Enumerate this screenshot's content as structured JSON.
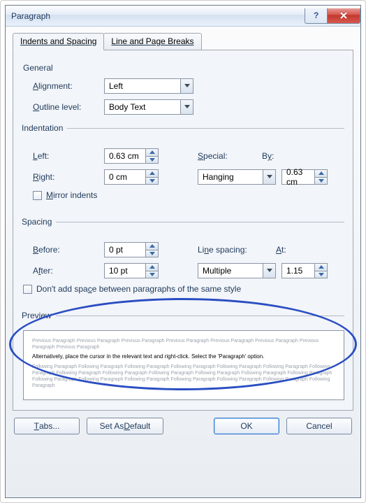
{
  "window": {
    "title": "Paragraph"
  },
  "tabs": {
    "indents": "Indents and Spacing",
    "linepage": "Line and Page Breaks"
  },
  "general": {
    "heading": "General",
    "alignment_label": "Alignment:",
    "alignment_value": "Left",
    "outline_label": "Outline level:",
    "outline_value": "Body Text"
  },
  "indentation": {
    "heading": "Indentation",
    "left_label": "Left:",
    "left_value": "0.63 cm",
    "right_label": "Right:",
    "right_value": "0 cm",
    "special_label": "Special:",
    "special_value": "Hanging",
    "by_label": "By:",
    "by_value": "0.63 cm",
    "mirror_label": "Mirror indents"
  },
  "spacing": {
    "heading": "Spacing",
    "before_label": "Before:",
    "before_value": "0 pt",
    "after_label": "After:",
    "after_value": "10 pt",
    "line_label": "Line spacing:",
    "line_value": "Multiple",
    "at_label": "At:",
    "at_value": "1.15",
    "noadd_label": "Don't add space between paragraphs of the same style"
  },
  "preview": {
    "heading": "Preview",
    "prev_text": "Previous Paragraph Previous Paragraph Previous Paragraph Previous Paragraph Previous Paragraph Previous Paragraph Previous Paragraph Previous Paragraph",
    "main_text": "Alternatively, place the cursor in the relevant text and right-click. Select the 'Paragraph' option.",
    "next_text": "Following Paragraph Following Paragraph Following Paragraph Following Paragraph Following Paragraph Following Paragraph Following Paragraph Following Paragraph Following Paragraph Following Paragraph Following Paragraph Following Paragraph Following Paragraph Following Paragraph Following Paragraph Following Paragraph Following Paragraph Following Paragraph Following Paragraph Following Paragraph"
  },
  "buttons": {
    "tabs": "Tabs...",
    "setdefault": "Set As Default",
    "ok": "OK",
    "cancel": "Cancel"
  }
}
